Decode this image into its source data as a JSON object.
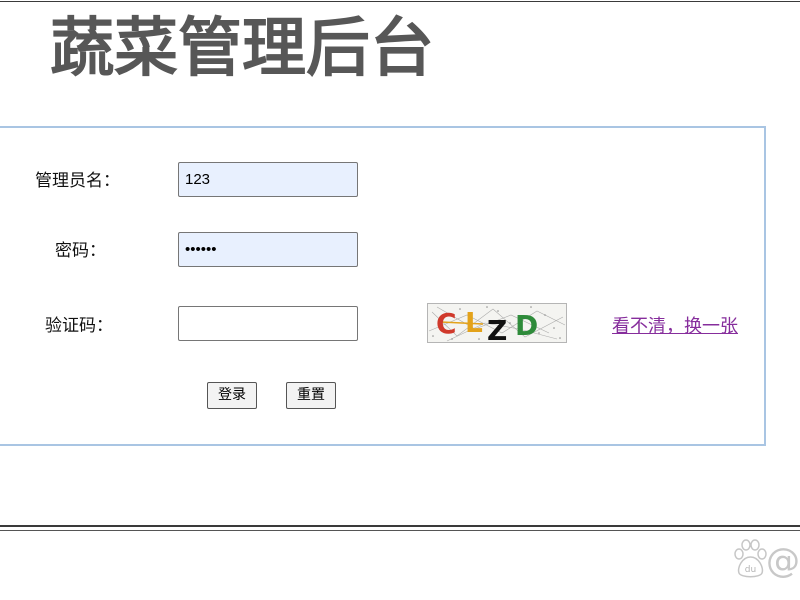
{
  "page": {
    "title": "蔬菜管理后台"
  },
  "form": {
    "username": {
      "label": "管理员名：",
      "value": "123"
    },
    "password": {
      "label": "密码：",
      "value": "••••••"
    },
    "captcha": {
      "label": "验证码：",
      "value": "",
      "letters": [
        {
          "char": "C",
          "color": "#d0392b"
        },
        {
          "char": "L",
          "color": "#e3a21a"
        },
        {
          "char": "Z",
          "color": "#111111"
        },
        {
          "char": "D",
          "color": "#2e8b3a"
        }
      ],
      "refresh_link": "看不清，换一张"
    }
  },
  "buttons": {
    "login": "登录",
    "reset": "重置"
  },
  "watermark": {
    "icon": "baidu-paw-icon",
    "logo_text": "du",
    "symbol": "@"
  },
  "colors": {
    "title": "#575757",
    "box_border": "#a9c5e3",
    "link": "#862d9c",
    "autofill_background": "#e8f0fe"
  }
}
